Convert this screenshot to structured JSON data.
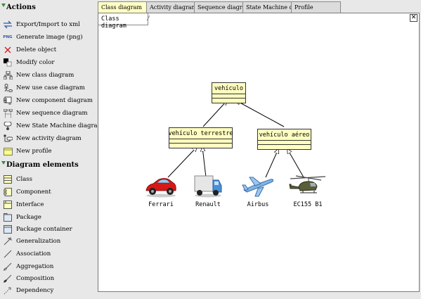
{
  "sidebar": {
    "actions_title": "Actions",
    "actions": [
      {
        "label": "Export/Import to xml",
        "icon": "export-import-icon"
      },
      {
        "label": "Generate image (png)",
        "icon": "png-icon",
        "icon_text": "PNG"
      },
      {
        "label": "Delete object",
        "icon": "delete-icon"
      },
      {
        "label": "Modify color",
        "icon": "color-icon"
      },
      {
        "label": "New class diagram",
        "icon": "class-diagram-icon"
      },
      {
        "label": "New use case diagram",
        "icon": "use-case-diagram-icon"
      },
      {
        "label": "New component diagram",
        "icon": "component-diagram-icon"
      },
      {
        "label": "New sequence diagram",
        "icon": "sequence-diagram-icon"
      },
      {
        "label": "New State Machine diagram",
        "icon": "state-machine-diagram-icon"
      },
      {
        "label": "New activity diagram",
        "icon": "activity-diagram-icon"
      },
      {
        "label": "New profile",
        "icon": "profile-icon"
      }
    ],
    "elements_title": "Diagram elements",
    "elements": [
      {
        "label": "Class",
        "icon": "class-icon"
      },
      {
        "label": "Component",
        "icon": "component-icon"
      },
      {
        "label": "Interface",
        "icon": "interface-icon"
      },
      {
        "label": "Package",
        "icon": "package-icon"
      },
      {
        "label": "Package container",
        "icon": "package-container-icon"
      },
      {
        "label": "Generalization",
        "icon": "generalization-icon"
      },
      {
        "label": "Association",
        "icon": "association-icon"
      },
      {
        "label": "Aggregation",
        "icon": "aggregation-icon"
      },
      {
        "label": "Composition",
        "icon": "composition-icon"
      },
      {
        "label": "Dependency",
        "icon": "dependency-icon"
      }
    ]
  },
  "tabs": [
    {
      "label": "Class diagram",
      "active": true
    },
    {
      "label": "Activity diagram",
      "active": false
    },
    {
      "label": "Sequence diagram",
      "active": false
    },
    {
      "label": "State Machine dia...",
      "active": false
    },
    {
      "label": "Profile",
      "active": false
    }
  ],
  "diagram": {
    "name": "Class diagram",
    "close_symbol": "✕",
    "classes": {
      "root": "vehículo",
      "land": "vehículo terrestre",
      "air": "vehículo aéreo"
    },
    "instances": {
      "ferrari": "Ferrari",
      "renault": "Renault",
      "airbus": "Airbus",
      "ec155": "EC155 B1"
    }
  },
  "colors": {
    "class_fill": "#ffffc0",
    "active_tab": "#ffffc6",
    "background": "#e8e8e8"
  }
}
